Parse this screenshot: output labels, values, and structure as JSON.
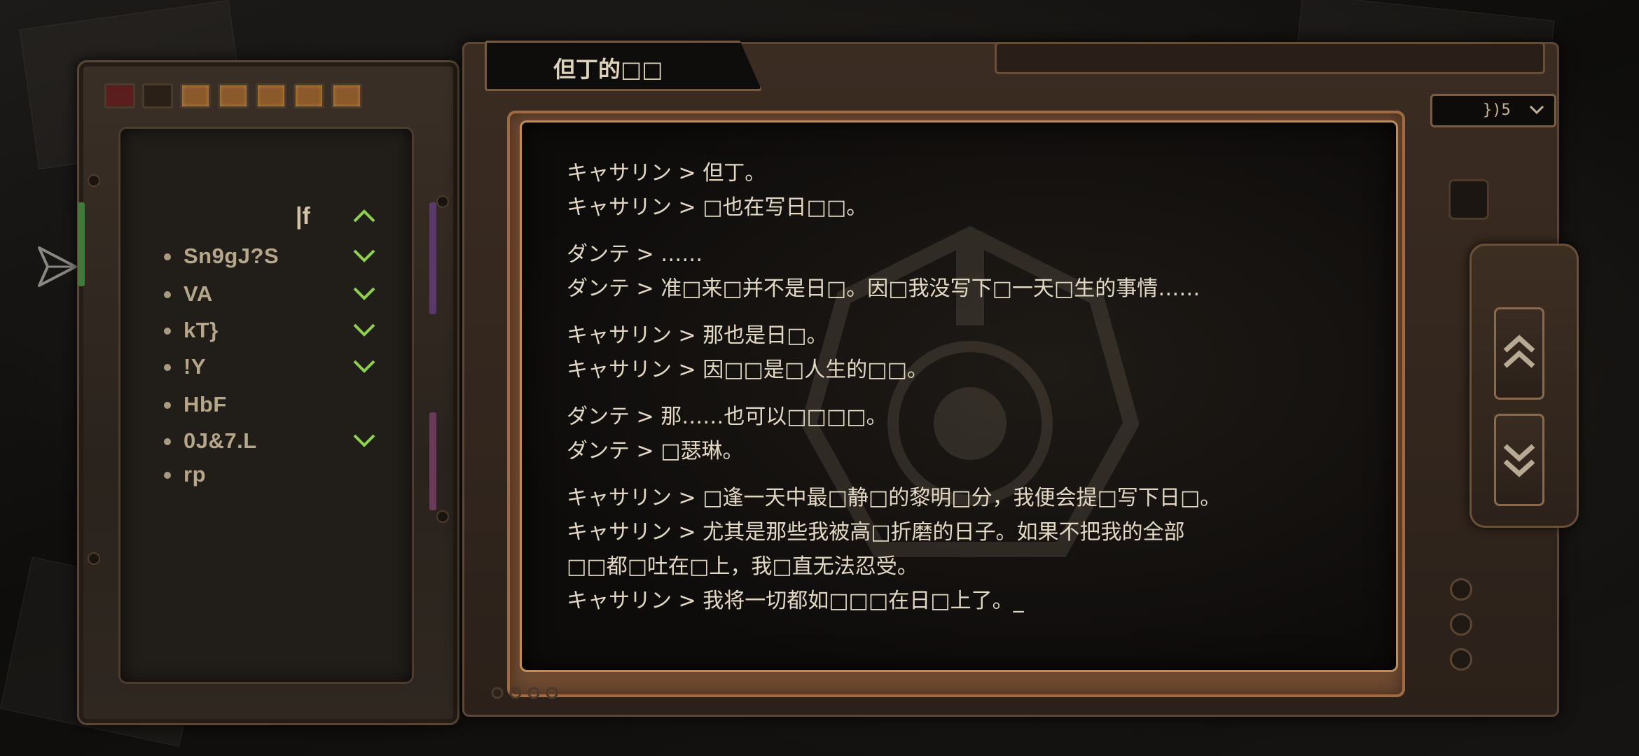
{
  "window": {
    "title": "但丁的□□"
  },
  "dropdown": {
    "value": "})5"
  },
  "nav": {
    "header": "|f",
    "items": [
      {
        "label": "Sn9gJ?S",
        "expandable": true
      },
      {
        "label": "VA",
        "expandable": true
      },
      {
        "label": "kT}",
        "expandable": true
      },
      {
        "label": "!Y",
        "expandable": true
      },
      {
        "label": "HbF",
        "expandable": false
      },
      {
        "label": "0J&7.L",
        "expandable": true
      },
      {
        "label": "rp",
        "expandable": false
      }
    ]
  },
  "log": {
    "groups": [
      [
        "キャサリン > 但丁。",
        "キャサリン > □也在写日□□。"
      ],
      [
        "ダンテ > ……",
        "ダンテ > 准□来□并不是日□。因□我没写下□一天□生的事情……"
      ],
      [
        "キャサリン > 那也是日□。",
        "キャサリン > 因□□是□人生的□□。"
      ],
      [
        "ダンテ > 那……也可以□□□□。",
        "ダンテ > □瑟琳。"
      ],
      [
        "キャサリン > □逢一天中最□静□的黎明□分，我便会提□写下日□。",
        "キャサリン > 尤其是那些我被高□折磨的日子。如果不把我的全部",
        "□□都□吐在□上，我□直无法忍受。",
        "キャサリン > 我将一切都如□□□在日□上了。_"
      ]
    ]
  },
  "colors": {
    "accent_green": "#8fd14f",
    "panel_brown": "#3b2c22",
    "text_light": "#e2d8c4",
    "frame_copper": "#c08c5a"
  },
  "icons": {
    "share": "share-icon",
    "scroll_up": "double-chevron-up-icon",
    "scroll_down": "double-chevron-down-icon",
    "expand": "chevron-down-icon",
    "collapse": "chevron-up-icon",
    "dropdown": "chevron-down-icon"
  }
}
